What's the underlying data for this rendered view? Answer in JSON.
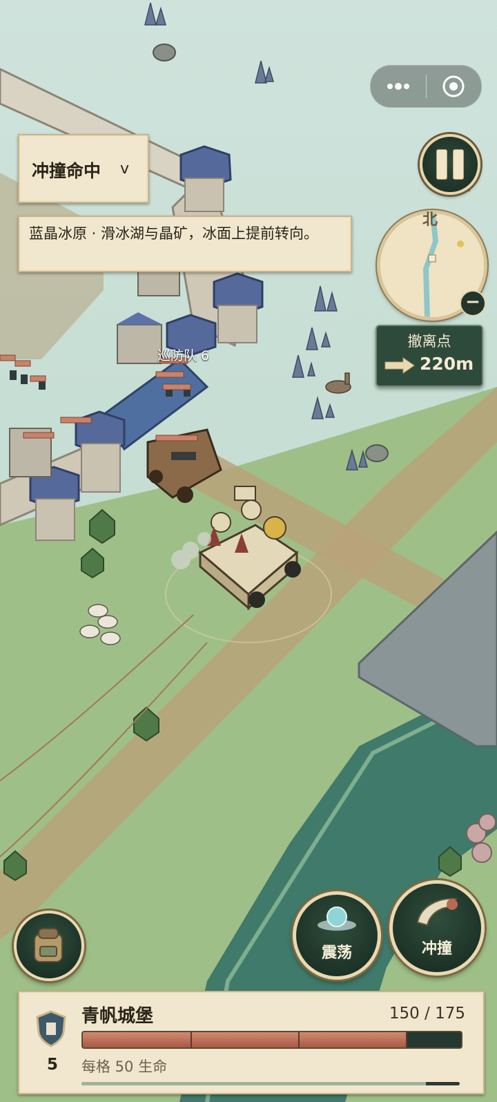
{
  "capsule": {
    "more_icon": "more-dots-icon",
    "close_icon": "target-circle-icon"
  },
  "mode_selector": {
    "label": "冲撞命中",
    "chevron": "v"
  },
  "description": {
    "text": "蓝晶冰原 · 滑冰湖与晶矿，冰面上提前转向。"
  },
  "minimap": {
    "north_label": "北",
    "zoom_out_label": "−"
  },
  "evac": {
    "title": "撤离点",
    "distance": "220m"
  },
  "world": {
    "patrol_label": "巡防队 6"
  },
  "abilities": {
    "shock_label": "震荡",
    "ram_label": "冲撞"
  },
  "status": {
    "name": "青帆城堡",
    "level": "5",
    "hp_text": "150 / 175",
    "hp_fraction": 0.857,
    "per_cell": "每格 50 生命",
    "sub_progress": 0.91
  },
  "colors": {
    "panel_green": "#2e4a3b",
    "parchment": "#f1e7cf",
    "hp_red": "#b86a52",
    "frame_gold": "#e9d9b1"
  }
}
